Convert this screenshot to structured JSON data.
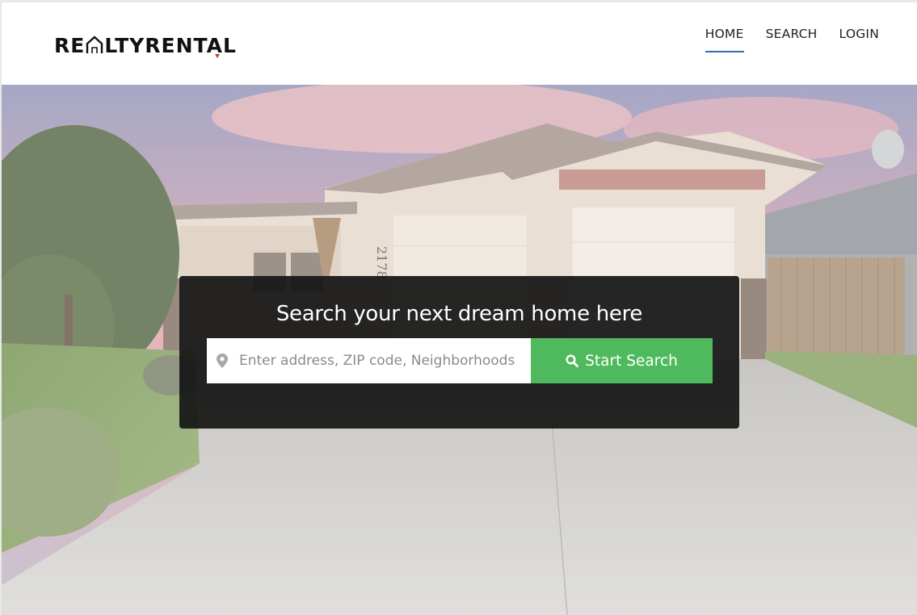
{
  "brand": {
    "logo_text_left": "RE",
    "logo_text_right": "LTYRENTAL"
  },
  "nav": {
    "items": [
      {
        "label": "HOME",
        "active": true
      },
      {
        "label": "SEARCH",
        "active": false
      },
      {
        "label": "LOGIN",
        "active": false
      }
    ]
  },
  "hero": {
    "house_number": "2178",
    "search": {
      "title": "Search your next dream home here",
      "placeholder": "Enter address, ZIP code, Neighborhoods",
      "value": "",
      "button_label": "Start Search",
      "button_color": "#4fba5d"
    }
  },
  "colors": {
    "accent": "#2f6bb5",
    "panel": "#161616",
    "brand_mark": "#c0392b"
  },
  "icons": {
    "location": "map-pin-icon",
    "search": "search-icon",
    "logo": "house-icon"
  }
}
